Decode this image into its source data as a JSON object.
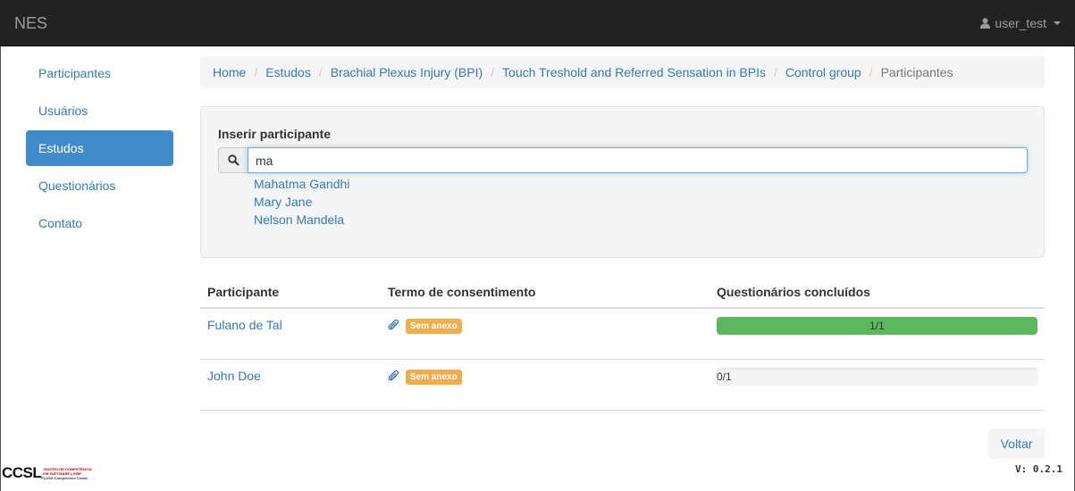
{
  "navbar": {
    "brand": "NES",
    "user": "user_test"
  },
  "sidebar": {
    "items": [
      {
        "label": "Participantes",
        "active": false
      },
      {
        "label": "Usuários",
        "active": false
      },
      {
        "label": "Estudos",
        "active": true
      },
      {
        "label": "Questionários",
        "active": false
      },
      {
        "label": "Contato",
        "active": false
      }
    ]
  },
  "breadcrumb": {
    "items": [
      "Home",
      "Estudos",
      "Brachial Plexus Injury (BPI)",
      "Touch Treshold and Referred Sensation in BPIs",
      "Control group"
    ],
    "active": "Participantes"
  },
  "insert": {
    "label": "Inserir participante",
    "value": "ma",
    "suggestions": [
      "Mahatma Gandhi",
      "Mary Jane",
      "Nelson Mandela"
    ]
  },
  "table": {
    "headers": [
      "Participante",
      "Termo de consentimento",
      "Questionários concluídos"
    ],
    "rows": [
      {
        "name": "Fulano de Tal",
        "badge": "Sem anexo",
        "progress_text": "1/1",
        "progress": 1.0
      },
      {
        "name": "John Doe",
        "badge": "Sem anexo",
        "progress_text": "0/1",
        "progress": 0.0
      }
    ]
  },
  "footer": {
    "back_label": "Voltar",
    "version": "V: 0.2.1",
    "logo_main": "CCSL",
    "logo_sub": "CENTRO DE COMPETÊNCIA EM SOFTWARE LIVRE",
    "logo_sub2": "FLOSS Competence Center"
  },
  "colors": {
    "navbar_bg": "#222222",
    "link": "#337ab7",
    "active_nav": "#428bca",
    "success": "#5cb85c",
    "warning": "#f0ad4e"
  }
}
